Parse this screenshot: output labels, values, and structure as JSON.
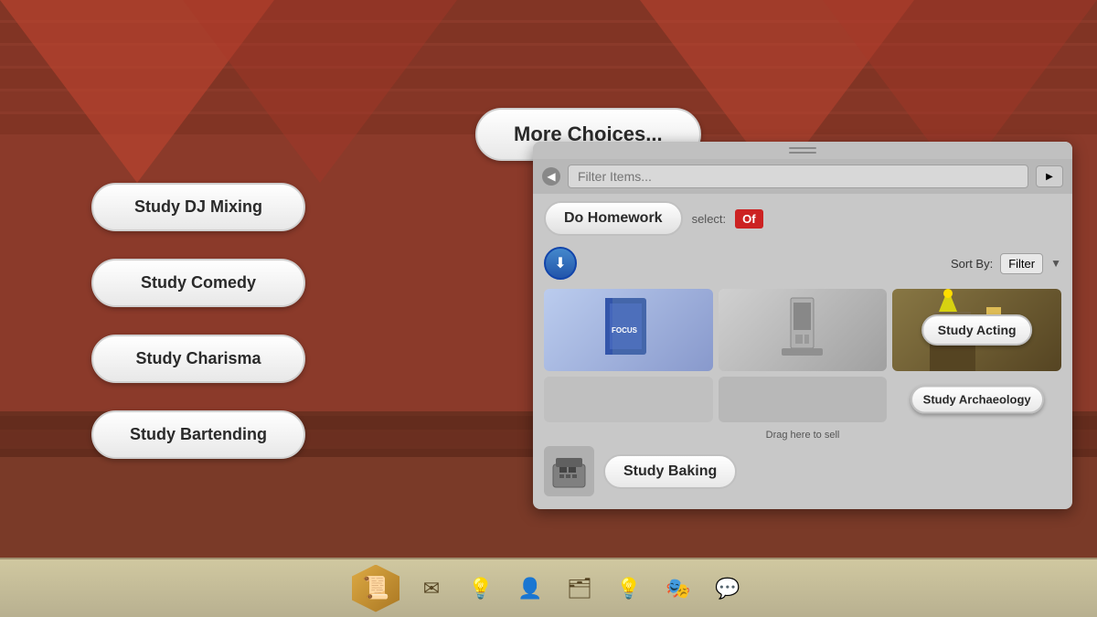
{
  "background": {
    "color": "#7a3a28"
  },
  "buttons": {
    "more_choices": "More Choices...",
    "study_dj": "Study DJ Mixing",
    "study_comedy": "Study Comedy",
    "study_charisma": "Study Charisma",
    "study_bartending": "Study Bartending"
  },
  "panel": {
    "handle_lines": 2,
    "filter_placeholder": "Filter Items...",
    "homework_btn": "Do Homework",
    "select_label": "select:",
    "select_value": "Of",
    "sort_label": "Sort By:",
    "sort_value": "Filter",
    "study_acting_btn": "Study Acting",
    "study_archaeology_btn": "Study Archaeology",
    "drag_text": "Drag here to sell",
    "study_baking_btn": "Study Baking"
  },
  "taskbar": {
    "icons": [
      "📧",
      "💡",
      "👥",
      "🗂",
      "💡",
      "🎭",
      "💬"
    ]
  }
}
